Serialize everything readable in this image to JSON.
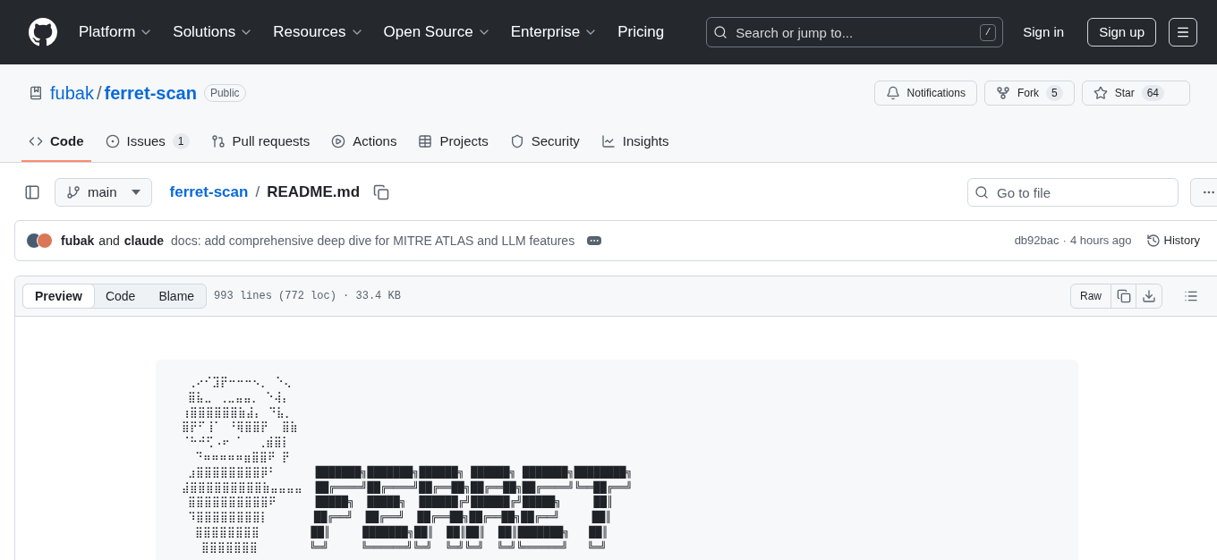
{
  "header": {
    "nav": [
      "Platform",
      "Solutions",
      "Resources",
      "Open Source",
      "Enterprise"
    ],
    "pricing": "Pricing",
    "search": {
      "placeholder": "Search or jump to...",
      "shortcut": "/"
    },
    "sign_in": "Sign in",
    "sign_up": "Sign up"
  },
  "repo": {
    "owner": "fubak",
    "separator": "/",
    "name": "ferret-scan",
    "visibility": "Public",
    "actions": [
      {
        "kind": "notifications",
        "label": "Notifications"
      },
      {
        "kind": "fork",
        "label": "Fork",
        "count": "5"
      },
      {
        "kind": "star",
        "label": "Star",
        "count": "64"
      }
    ]
  },
  "tabs": [
    {
      "kind": "code",
      "label": "Code",
      "selected": true
    },
    {
      "kind": "issues",
      "label": "Issues",
      "count": "1",
      "selected": false
    },
    {
      "kind": "pulls",
      "label": "Pull requests",
      "selected": false
    },
    {
      "kind": "actions",
      "label": "Actions",
      "selected": false
    },
    {
      "kind": "projects",
      "label": "Projects",
      "selected": false
    },
    {
      "kind": "security",
      "label": "Security",
      "selected": false
    },
    {
      "kind": "insights",
      "label": "Insights",
      "selected": false
    }
  ],
  "file": {
    "branch": "main",
    "repo_link": "ferret-scan",
    "separator": "/",
    "file_name": "README.md",
    "go_to_file": {
      "placeholder": "Go to file"
    }
  },
  "commit": {
    "author_1": "fubak",
    "conjunction": "and",
    "author_2": "claude",
    "message": "docs: add comprehensive deep dive for MITRE ATLAS and LLM features",
    "sha": "db92bac",
    "separator": "·",
    "time": "4 hours ago",
    "history": "History"
  },
  "viewer": {
    "modes": [
      {
        "label": "Preview",
        "selected": true
      },
      {
        "label": "Code",
        "selected": false
      },
      {
        "label": "Blame",
        "selected": false
      }
    ],
    "info": "993 lines (772 loc) · 33.4 KB",
    "raw": "Raw"
  },
  "readme": {
    "ascii_art": [
      "  ⢀⠔⠊⣹⡟⠒⠒⠒⠢⡀ ⠑⢄",
      "  ⣿⣧⣀ ⢀⣀⣤⣤⡀ ⠑⢼⡄",
      " ⢰⣿⣿⣿⣿⣿⣿⣷⣼⡄ ⠙⣧⡀",
      " ⣿⡟⠋⢸⠁ ⠘⢿⣿⣿⡟  ⣿⣷",
      " ⠈⠓⠚⢋⠠⠖ ⠁  ⢀⣾⣿⡇",
      "   ⠙⠶⠶⠶⠶⠶⣶⣿⣿⠟ ⡟",
      "  ⣰⣿⣿⣿⣿⣿⣿⣿⣿⡿⠃      ███████╗███████╗██████╗ ██████╗ ███████╗████████╗",
      " ⣼⣿⣿⣿⣿⣿⣿⣿⣿⣿⣷⣤⣤⣤⣤  ██╔════╝██╔════╝██╔══██╗██╔══██╗██╔════╝╚══██╔══╝",
      "  ⣿⣿⣿⣿⣿⣿⣿⣿⣿⣿⠟      █████╗  █████╗  ██████╔╝██████╔╝█████╗     ██║",
      "  ⠹⣿⣿⣿⣿⣿⣿⣿⣿⡇       ██╔══╝  ██╔══╝  ██╔══██╗██╔══██╗██╔══╝     ██║",
      "   ⣿⣿⣿⣿⣿⣿⣿⣿        ██║     ███████╗██║  ██║██║  ██║███████╗   ██║",
      "    ⣿⣿⣿⣿⣿⣿⣿        ╚═╝     ╚══════╝╚═╝  ╚═╝╚═╝  ╚═╝╚══════╝   ╚═╝"
    ]
  }
}
